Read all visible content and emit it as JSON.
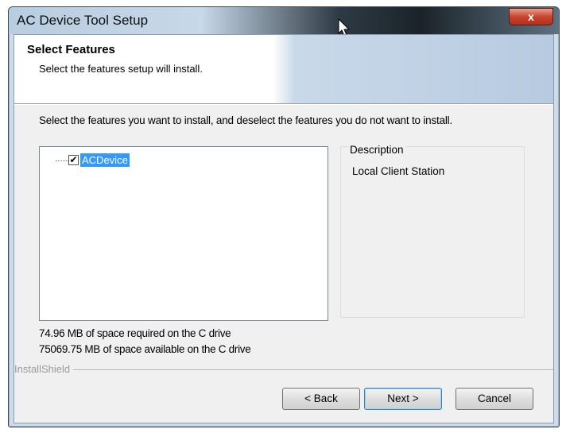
{
  "window": {
    "title": "AC Device Tool Setup",
    "close_label": "x"
  },
  "header": {
    "title": "Select Features",
    "subtitle": "Select the features setup will install."
  },
  "instruction": "Select the features you want to install, and deselect the features you do not want to install.",
  "feature_tree": {
    "items": [
      {
        "label": "ACDevice",
        "checked": true,
        "check_glyph": "✔"
      }
    ]
  },
  "description": {
    "label": "Description",
    "text": "Local Client Station"
  },
  "disk_space": {
    "required": "74.96 MB of space required on the C drive",
    "available": "75069.75 MB of space available on the C drive"
  },
  "branding": "InstallShield",
  "buttons": {
    "back": "< Back",
    "next": "Next >",
    "cancel": "Cancel"
  },
  "colors": {
    "selection": "#3399ff",
    "close_button": "#c8452f"
  }
}
